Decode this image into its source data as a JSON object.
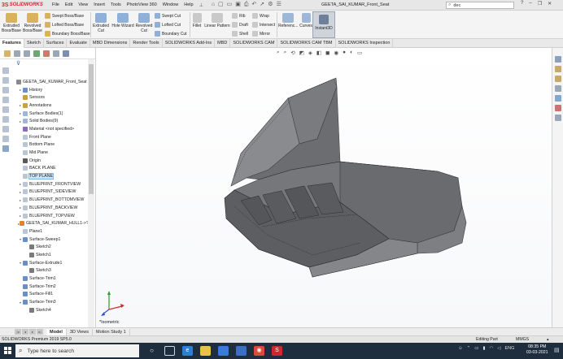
{
  "app": {
    "logo_mark": "3S",
    "logo_text": "SOLIDWORKS",
    "menu": [
      "File",
      "Edit",
      "View",
      "Insert",
      "Tools",
      "PhotoView 360",
      "Window",
      "Help"
    ],
    "document_title": "GEETA_SAI_KUMAR_Front_Seat",
    "search_value": "dec",
    "window_controls": [
      "?",
      "–",
      "❐",
      "✕"
    ]
  },
  "ribbon": {
    "extruded_boss": "Extruded Boss/Base",
    "revolved_boss": "Revolved Boss/Base",
    "swept_boss": "Swept Boss/Base",
    "lofted_boss": "Lofted Boss/Base",
    "boundary_boss": "Boundary Boss/Base",
    "extruded_cut": "Extruded Cut",
    "hole_wizard": "Hole Wizard",
    "revolved_cut": "Revolved Cut",
    "swept_cut": "Swept Cut",
    "lofted_cut": "Lofted Cut",
    "boundary_cut": "Boundary Cut",
    "fillet": "Fillet",
    "linear_pattern": "Linear Pattern",
    "rib": "Rib",
    "draft": "Draft",
    "shell": "Shell",
    "wrap": "Wrap",
    "intersect": "Intersect",
    "mirror": "Mirror",
    "reference": "Referenc...",
    "curves": "Curves",
    "instant3d": "Instant3D"
  },
  "command_tabs": [
    "Features",
    "Sketch",
    "Surfaces",
    "Evaluate",
    "MBD Dimensions",
    "Render Tools",
    "SOLIDWORKS Add-Ins",
    "MBD",
    "SOLIDWORKS CAM",
    "SOLIDWORKS CAM TBM",
    "SOLIDWORKS Inspection"
  ],
  "feature_tree": [
    {
      "label": "GEETA_SAI_KUMAR_Front_Seat",
      "indent": 0,
      "arrow": "",
      "color": "#8a8a8a"
    },
    {
      "label": "History",
      "indent": 1,
      "arrow": "▸",
      "color": "#6a8fc4"
    },
    {
      "label": "Sensors",
      "indent": 1,
      "arrow": "",
      "color": "#c9a23a"
    },
    {
      "label": "Annotations",
      "indent": 1,
      "arrow": "▸",
      "color": "#c9a23a"
    },
    {
      "label": "Surface Bodies(1)",
      "indent": 1,
      "arrow": "▸",
      "color": "#9fb7d6"
    },
    {
      "label": "Solid Bodies(9)",
      "indent": 1,
      "arrow": "▸",
      "color": "#9fb7d6"
    },
    {
      "label": "Material <not specified>",
      "indent": 1,
      "arrow": "",
      "color": "#8a6bbf"
    },
    {
      "label": "Front Plane",
      "indent": 1,
      "arrow": "",
      "color": "#b9c6d6"
    },
    {
      "label": "Bottom Plane",
      "indent": 1,
      "arrow": "",
      "color": "#b9c6d6"
    },
    {
      "label": "Mid Plane",
      "indent": 1,
      "arrow": "",
      "color": "#b9c6d6"
    },
    {
      "label": "Origin",
      "indent": 1,
      "arrow": "",
      "color": "#5a5a5a"
    },
    {
      "label": "BACK PLANE",
      "indent": 1,
      "arrow": "",
      "color": "#b9c6d6"
    },
    {
      "label": "TOP PLANE",
      "indent": 1,
      "arrow": "",
      "color": "#b9c6d6",
      "selected": true
    },
    {
      "label": "BLUEPRINT_FRONTVIEW",
      "indent": 1,
      "arrow": "▸",
      "color": "#b9c6d6"
    },
    {
      "label": "BLUEPRINT_SIDEVIEW",
      "indent": 1,
      "arrow": "▸",
      "color": "#b9c6d6"
    },
    {
      "label": "BLUEPRINT_BOTTOMVIEW",
      "indent": 1,
      "arrow": "▸",
      "color": "#b9c6d6"
    },
    {
      "label": "BLUEPRINT_BACKVIEW",
      "indent": 1,
      "arrow": "▸",
      "color": "#b9c6d6"
    },
    {
      "label": "BLUEPRINT_TOPVIEW",
      "indent": 1,
      "arrow": "▸",
      "color": "#b9c6d6"
    },
    {
      "label": "GEETA_SAI_KUMAR_HULL1->?",
      "indent": 1,
      "arrow": "▸",
      "color": "#d88a2a"
    },
    {
      "label": "Plane1",
      "indent": 1,
      "arrow": "",
      "color": "#b9c6d6"
    },
    {
      "label": "Surface-Sweep1",
      "indent": 1,
      "arrow": "▾",
      "color": "#6a8fc4"
    },
    {
      "label": "Sketch2",
      "indent": 2,
      "arrow": "",
      "color": "#7a7a7a"
    },
    {
      "label": "Sketch1",
      "indent": 2,
      "arrow": "",
      "color": "#7a7a7a"
    },
    {
      "label": "Surface-Extrude1",
      "indent": 1,
      "arrow": "▾",
      "color": "#6a8fc4"
    },
    {
      "label": "Sketch3",
      "indent": 2,
      "arrow": "",
      "color": "#7a7a7a"
    },
    {
      "label": "Surface-Trim1",
      "indent": 1,
      "arrow": "",
      "color": "#6a8fc4"
    },
    {
      "label": "Surface-Trim2",
      "indent": 1,
      "arrow": "",
      "color": "#6a8fc4"
    },
    {
      "label": "Surface-Fill1",
      "indent": 1,
      "arrow": "",
      "color": "#6a8fc4"
    },
    {
      "label": "Surface-Trim3",
      "indent": 1,
      "arrow": "▾",
      "color": "#6a8fc4"
    },
    {
      "label": "Sketch4",
      "indent": 2,
      "arrow": "",
      "color": "#7a7a7a"
    }
  ],
  "graphics": {
    "view_label": "*Isometric"
  },
  "bottom_tabs": [
    "Model",
    "3D Views",
    "Motion Study 1"
  ],
  "status": {
    "left": "SOLIDWORKS Premium 2019 SP5.0",
    "mode": "Editing Part",
    "units": "MMGS"
  },
  "taskbar": {
    "search_placeholder": "Type here to search",
    "lang": "ENG",
    "time": "08:35 PM",
    "date": "03-03-2021"
  }
}
